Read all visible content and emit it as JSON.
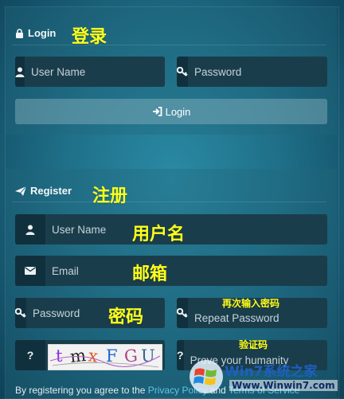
{
  "login": {
    "title": "Login",
    "annotation": "登录",
    "username_placeholder": "User Name",
    "password_placeholder": "Password",
    "button_label": "Login"
  },
  "register": {
    "title": "Register",
    "annotation": "注册",
    "username_placeholder": "User Name",
    "username_annotation": "用户名",
    "email_placeholder": "Email",
    "email_annotation": "邮箱",
    "password_placeholder": "Password",
    "password_annotation": "密码",
    "repeat_password_placeholder": "Repeat Password",
    "repeat_password_annotation": "再次输入密码",
    "captcha_icon_text": "?",
    "captcha_text": "tmxFGU",
    "humanity_icon_text": "?",
    "humanity_placeholder": "Prove your humanity",
    "humanity_annotation": "验证码"
  },
  "footer": {
    "prefix": "By registering you agree to the ",
    "privacy_link": "Privacy Policy",
    "middle": " and ",
    "terms_link": "Terms of Service"
  },
  "watermark": {
    "brand": "Win7系统之家",
    "url": "Www.Winwin7.com"
  },
  "colors": {
    "annotation": "#ffff1a",
    "link": "#5ec6e6",
    "field_bg": "#1a3d4c",
    "icon_bg": "#11303d"
  }
}
